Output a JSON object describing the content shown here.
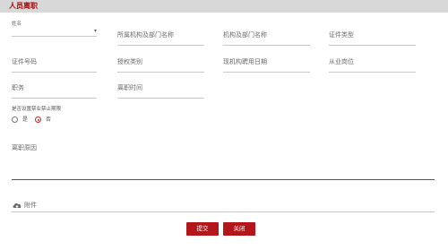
{
  "header": {
    "title": "人员离职"
  },
  "form": {
    "row1": [
      {
        "label": "姓名",
        "small": true
      },
      {
        "label": "所属机构及部门名称"
      },
      {
        "label": "机构及部门名称"
      },
      {
        "label": "证件类型"
      }
    ],
    "row2": [
      {
        "label": "证件号码"
      },
      {
        "label": "授权类别"
      },
      {
        "label": "现机构聘用日期"
      },
      {
        "label": "从业岗位"
      }
    ],
    "row3": [
      {
        "label": "职务"
      },
      {
        "label": "离职时间"
      }
    ],
    "question": "是否设置禁业禁止期限",
    "radio_options": [
      "是",
      "否"
    ],
    "radio_selected": "否",
    "reason_label": "离职原因",
    "attachment_label": "附件"
  },
  "buttons": {
    "submit": "提交",
    "cancel": "关闭"
  },
  "colors": {
    "accent": "#b3171b",
    "header_bg": "#d8d8d8"
  }
}
